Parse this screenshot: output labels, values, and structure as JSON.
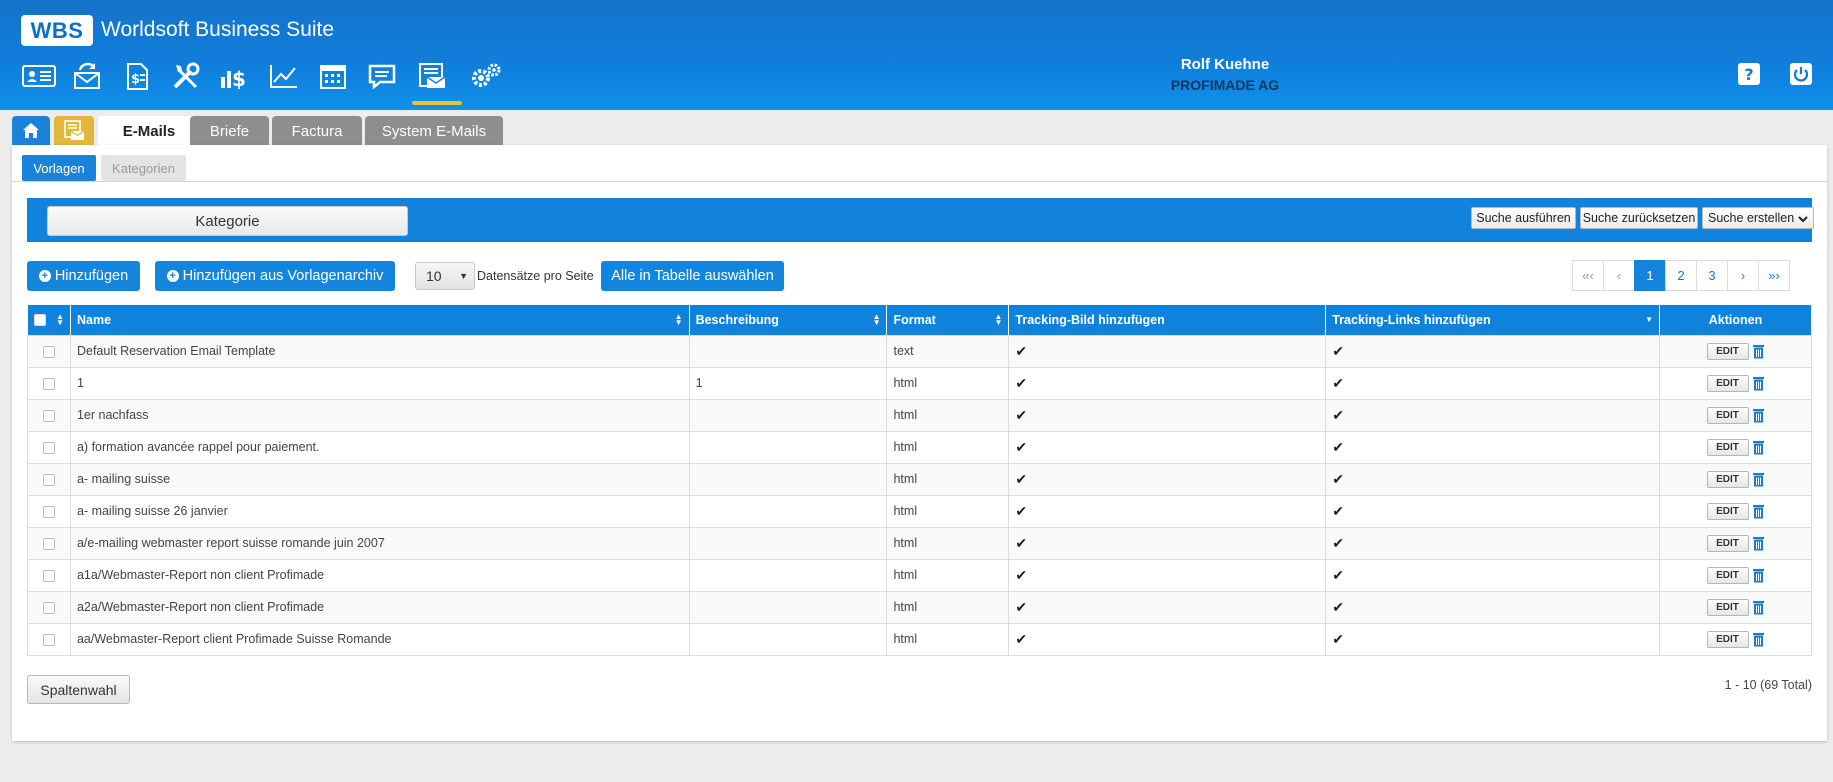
{
  "app": {
    "logo": "WBS",
    "title": "Worldsoft Business Suite"
  },
  "user": {
    "name": "Rolf Kuehne",
    "company": "PROFIMADE AG"
  },
  "nav_icons": [
    "contact-card-icon",
    "mail-recycle-icon",
    "invoice-document-icon",
    "tools-icon",
    "finance-dollar-icon",
    "line-chart-icon",
    "calendar-icon",
    "chat-bubble-icon",
    "newsletter-icon",
    "settings-gears-icon"
  ],
  "tabs": {
    "emails": "E-Mails",
    "briefe": "Briefe",
    "factura": "Factura",
    "system": "System E-Mails"
  },
  "subtabs": {
    "vorlagen": "Vorlagen",
    "kategorien": "Kategorien"
  },
  "filter": {
    "category": "Kategorie",
    "run": "Suche ausführen",
    "reset": "Suche zurücksetzen",
    "create": "Suche erstellen"
  },
  "toolbar": {
    "add": "Hinzufügen",
    "add_archive": "Hinzufügen aus Vorlagenarchiv",
    "per_page": "10",
    "per_page_label": "Datensätze pro Seite",
    "select_all": "Alle in Tabelle auswählen"
  },
  "pager": {
    "first": "«‹",
    "prev": "‹",
    "p1": "1",
    "p2": "2",
    "p3": "3",
    "next": "›",
    "last": "»›"
  },
  "table": {
    "headers": {
      "name": "Name",
      "description": "Beschreibung",
      "format": "Format",
      "tracking_image": "Tracking-Bild hinzufügen",
      "tracking_links": "Tracking-Links hinzufügen",
      "actions": "Aktionen"
    },
    "edit_label": "EDIT",
    "check": "✔",
    "rows": [
      {
        "name": "Default Reservation Email Template",
        "desc": "",
        "format": "text"
      },
      {
        "name": "1",
        "desc": "1",
        "format": "html"
      },
      {
        "name": "1er nachfass",
        "desc": "",
        "format": "html"
      },
      {
        "name": "a) formation avancée rappel pour paiement.",
        "desc": "",
        "format": "html"
      },
      {
        "name": "a- mailing suisse",
        "desc": "",
        "format": "html"
      },
      {
        "name": "a- mailing suisse 26 janvier",
        "desc": "",
        "format": "html"
      },
      {
        "name": "a/e-mailing webmaster report suisse romande juin 2007",
        "desc": "",
        "format": "html"
      },
      {
        "name": "a1a/Webmaster-Report non client Profimade",
        "desc": "",
        "format": "html"
      },
      {
        "name": "a2a/Webmaster-Report non client Profimade",
        "desc": "",
        "format": "html"
      },
      {
        "name": "aa/Webmaster-Report client Profimade Suisse Romande",
        "desc": "",
        "format": "html"
      }
    ]
  },
  "footer": {
    "columns": "Spaltenwahl",
    "total": "1 - 10 (69 Total)"
  },
  "colors": {
    "brand_blue": "#1183dc",
    "accent_yellow": "#e6c13a"
  }
}
